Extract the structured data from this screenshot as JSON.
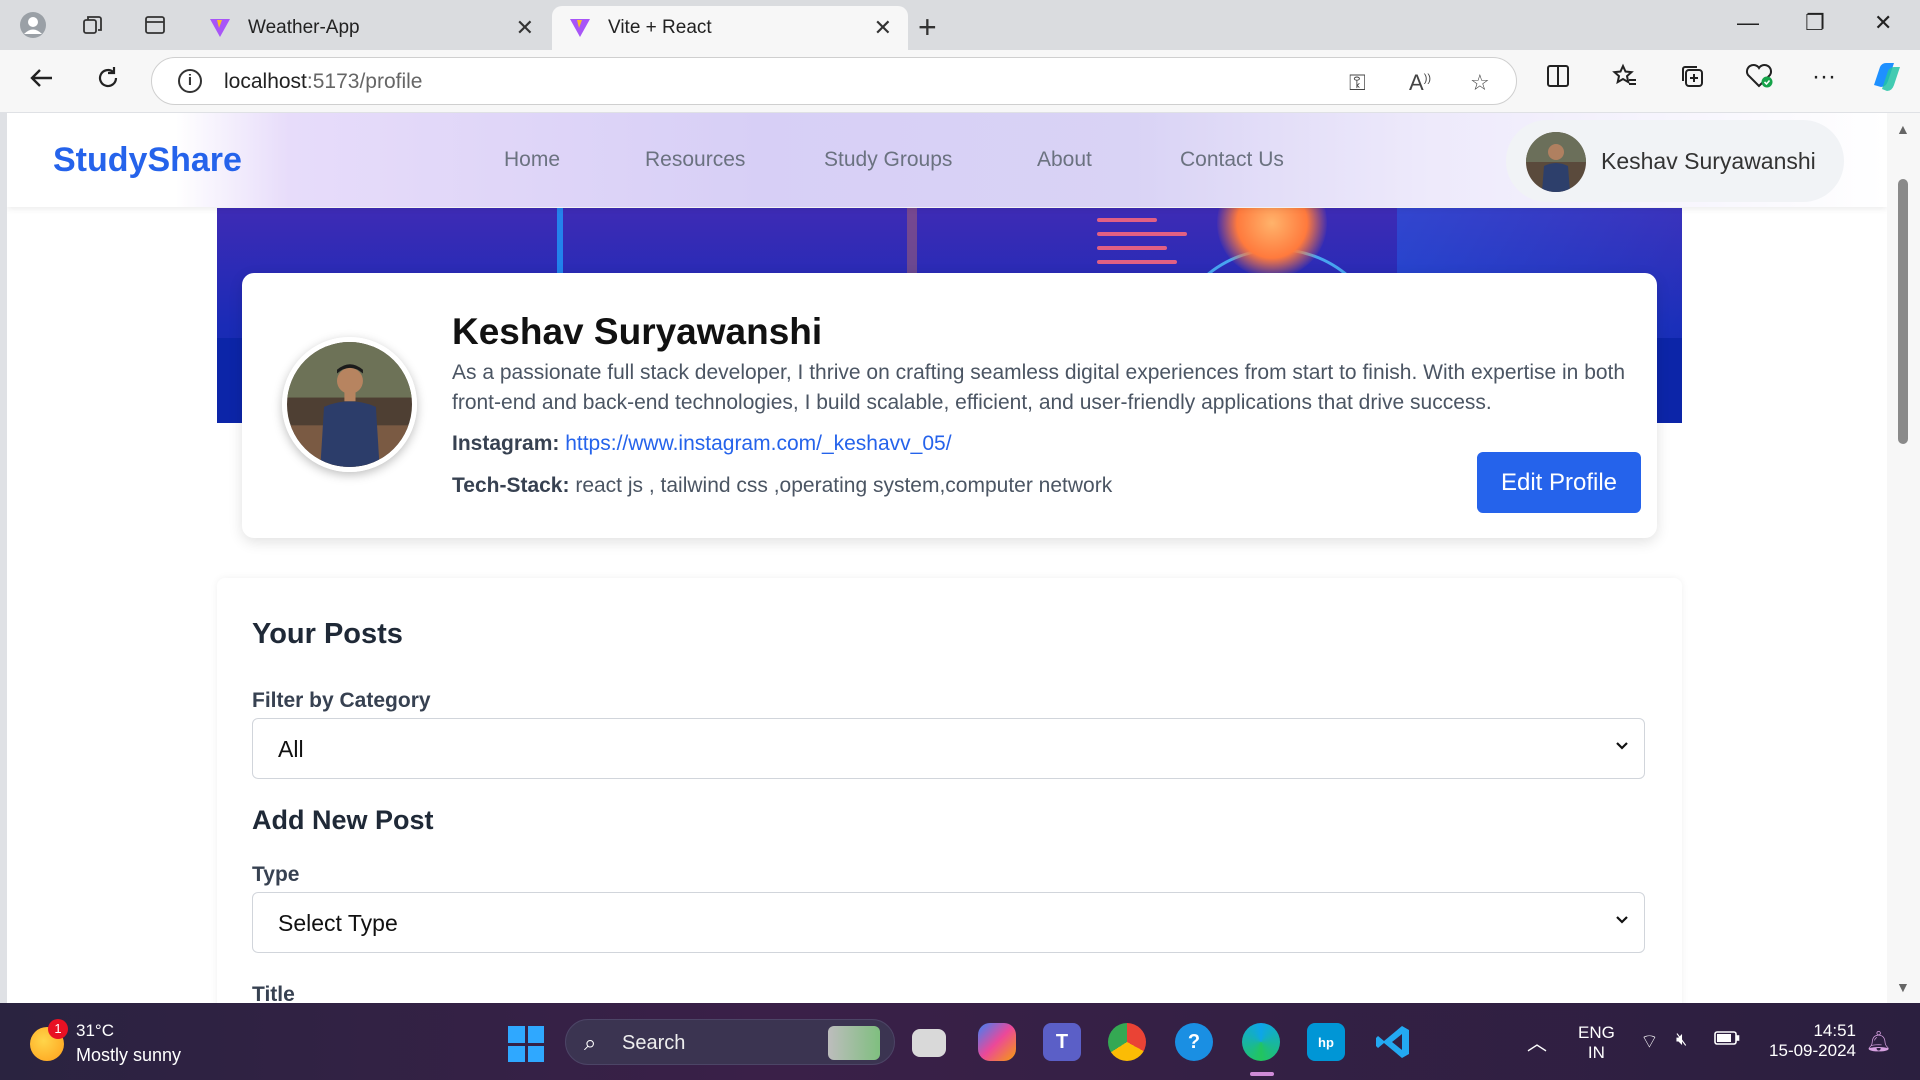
{
  "browser": {
    "tabs": [
      {
        "title": "Weather-App",
        "active": false
      },
      {
        "title": "Vite + React",
        "active": true
      }
    ],
    "url_host": "localhost",
    "url_path": ":5173/profile",
    "icons": [
      "profile-icon",
      "workspaces-icon",
      "tab-actions-icon",
      "back-icon",
      "refresh-icon",
      "info-icon",
      "password-key-icon",
      "read-aloud-icon",
      "favorite-star-icon",
      "split-screen-icon",
      "favorites-icon",
      "collections-icon",
      "browser-essentials-icon",
      "more-icon",
      "copilot-icon"
    ]
  },
  "navbar": {
    "brand": "StudyShare",
    "links": [
      "Home",
      "Resources",
      "Study Groups",
      "About",
      "Contact Us"
    ],
    "user_name": "Keshav Suryawanshi"
  },
  "profile": {
    "name": "Keshav Suryawanshi",
    "bio": "As a passionate full stack developer, I thrive on crafting seamless digital experiences from start to finish. With expertise in both front-end and back-end technologies, I build scalable, efficient, and user-friendly applications that drive success.",
    "instagram_label": "Instagram:",
    "instagram_url": "https://www.instagram.com/_keshavv_05/",
    "tech_label": "Tech-Stack:",
    "tech_stack": "react js , tailwind css ,operating system,computer network",
    "edit_button": "Edit Profile"
  },
  "posts": {
    "heading": "Your Posts",
    "filter_label": "Filter by Category",
    "filter_value": "All",
    "add_heading": "Add New Post",
    "type_label": "Type",
    "type_value": "Select Type",
    "title_label": "Title"
  },
  "taskbar": {
    "weather_temp": "31°C",
    "weather_desc": "Mostly sunny",
    "weather_badge": "1",
    "search_placeholder": "Search",
    "lang_top": "ENG",
    "lang_bottom": "IN",
    "time": "14:51",
    "date": "15-09-2024"
  },
  "colors": {
    "brand": "#2563eb",
    "button": "#2563eb",
    "banner": "#1a2bb6"
  }
}
